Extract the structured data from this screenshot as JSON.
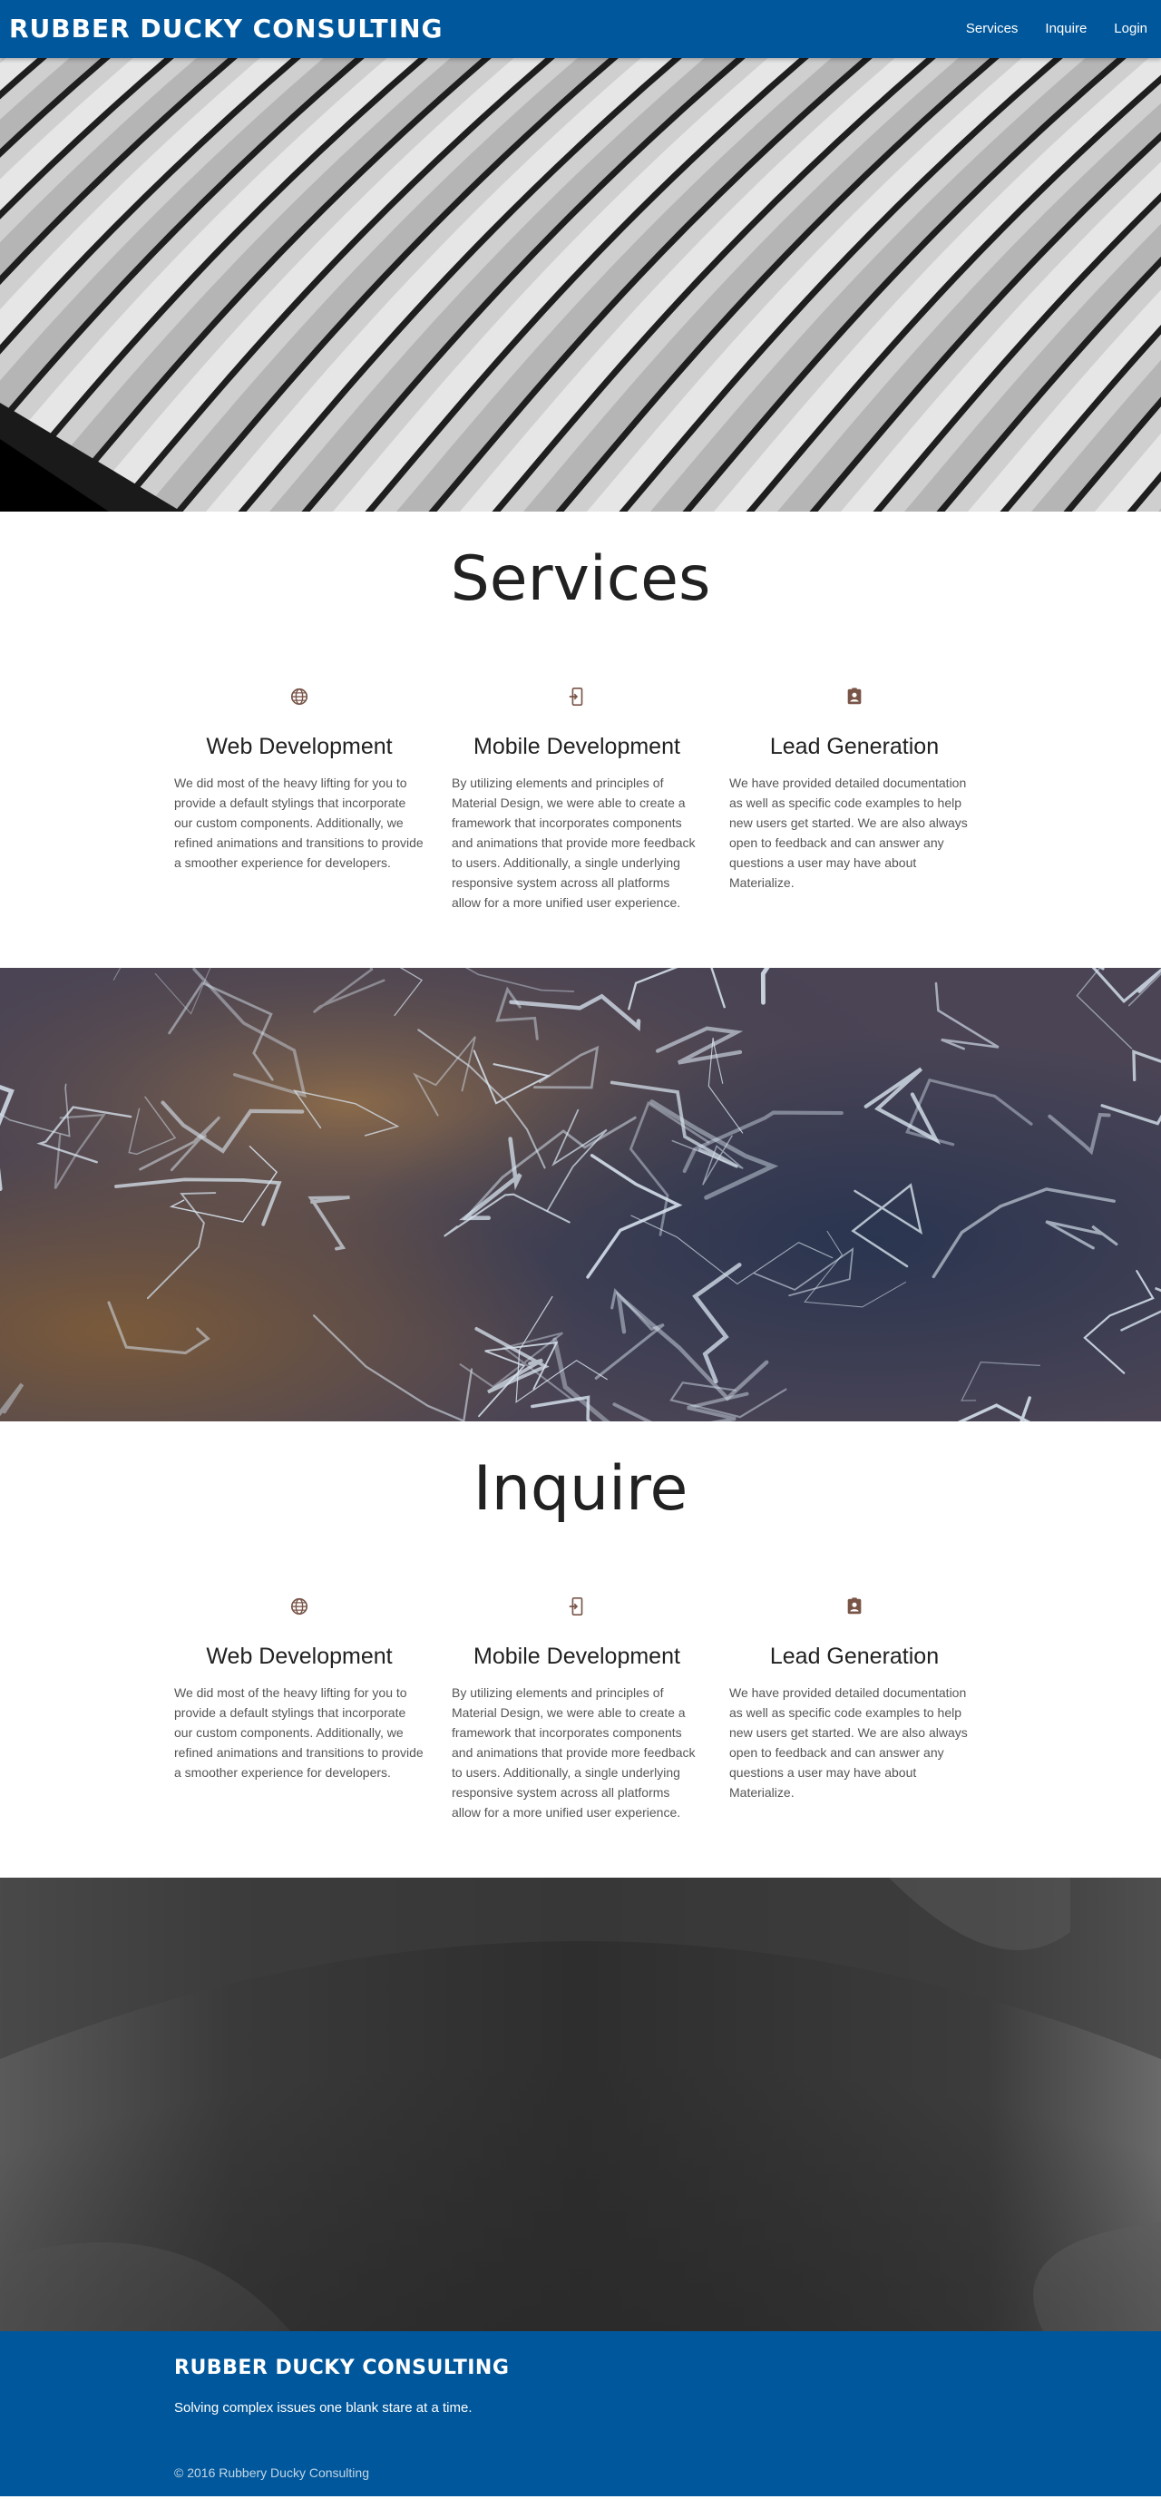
{
  "nav": {
    "brand": "RUBBER DUCKY CONSULTING",
    "links": [
      "Services",
      "Inquire",
      "Login"
    ]
  },
  "services": {
    "title": "Services",
    "items": [
      {
        "icon": "globe-icon",
        "title": "Web Development",
        "text": "We did most of the heavy lifting for you to provide a default stylings that incorporate our custom components. Additionally, we refined animations and transitions to provide a smoother experience for developers."
      },
      {
        "icon": "mobile-device-icon",
        "title": "Mobile Development",
        "text": "By utilizing elements and principles of Material Design, we were able to create a framework that incorporates components and animations that provide more feedback to users. Additionally, a single underlying responsive system across all platforms allow for a more unified user experience."
      },
      {
        "icon": "contact-card-icon",
        "title": "Lead Generation",
        "text": "We have provided detailed documentation as well as specific code examples to help new users get started. We are also always open to feedback and can answer any questions a user may have about Materialize."
      }
    ]
  },
  "inquire": {
    "title": "Inquire",
    "items": [
      {
        "icon": "globe-icon",
        "title": "Web Development",
        "text": "We did most of the heavy lifting for you to provide a default stylings that incorporate our custom components. Additionally, we refined animations and transitions to provide a smoother experience for developers."
      },
      {
        "icon": "mobile-device-icon",
        "title": "Mobile Development",
        "text": "By utilizing elements and principles of Material Design, we were able to create a framework that incorporates components and animations that provide more feedback to users. Additionally, a single underlying responsive system across all platforms allow for a more unified user experience."
      },
      {
        "icon": "contact-card-icon",
        "title": "Lead Generation",
        "text": "We have provided detailed documentation as well as specific code examples to help new users get started. We are also always open to feedback and can answer any questions a user may have about Materialize."
      }
    ]
  },
  "footer": {
    "title": "RUBBER DUCKY CONSULTING",
    "tagline": "Solving complex issues one blank stare at a time.",
    "copyright": "© 2016 Rubbery Ducky Consulting"
  },
  "colors": {
    "primary": "#01579b",
    "icon": "#795548",
    "text": "#212121"
  }
}
